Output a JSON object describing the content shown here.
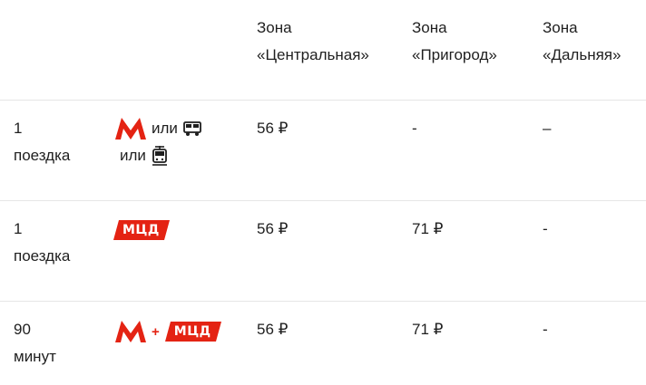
{
  "header": {
    "zone_central_line1": "Зона",
    "zone_central_line2": "«Центральная»",
    "zone_suburb_line1": "Зона",
    "zone_suburb_line2": "«Пригород»",
    "zone_far_line1": "Зона",
    "zone_far_line2": "«Дальняя»"
  },
  "rows": [
    {
      "duration_line1": "1",
      "duration_line2": "поездка",
      "transport": {
        "or1": "или",
        "or2": "или"
      },
      "central": "56 ₽",
      "suburb": "-",
      "far": "–"
    },
    {
      "duration_line1": "1",
      "duration_line2": "поездка",
      "transport": {
        "mcd_label": "МЦД"
      },
      "central": "56 ₽",
      "suburb": "71 ₽",
      "far": "-"
    },
    {
      "duration_line1": "90",
      "duration_line2": "минут",
      "transport": {
        "plus": "+",
        "mcd_label": "МЦД"
      },
      "central": "56 ₽",
      "suburb": "71 ₽",
      "far": "-"
    }
  ],
  "colors": {
    "metro_red": "#e42313",
    "divider": "#e6e6e6",
    "text": "#1f1f1f"
  },
  "icons": [
    "metro-logo-icon",
    "bus-icon",
    "tram-icon",
    "mcd-logo-icon"
  ]
}
